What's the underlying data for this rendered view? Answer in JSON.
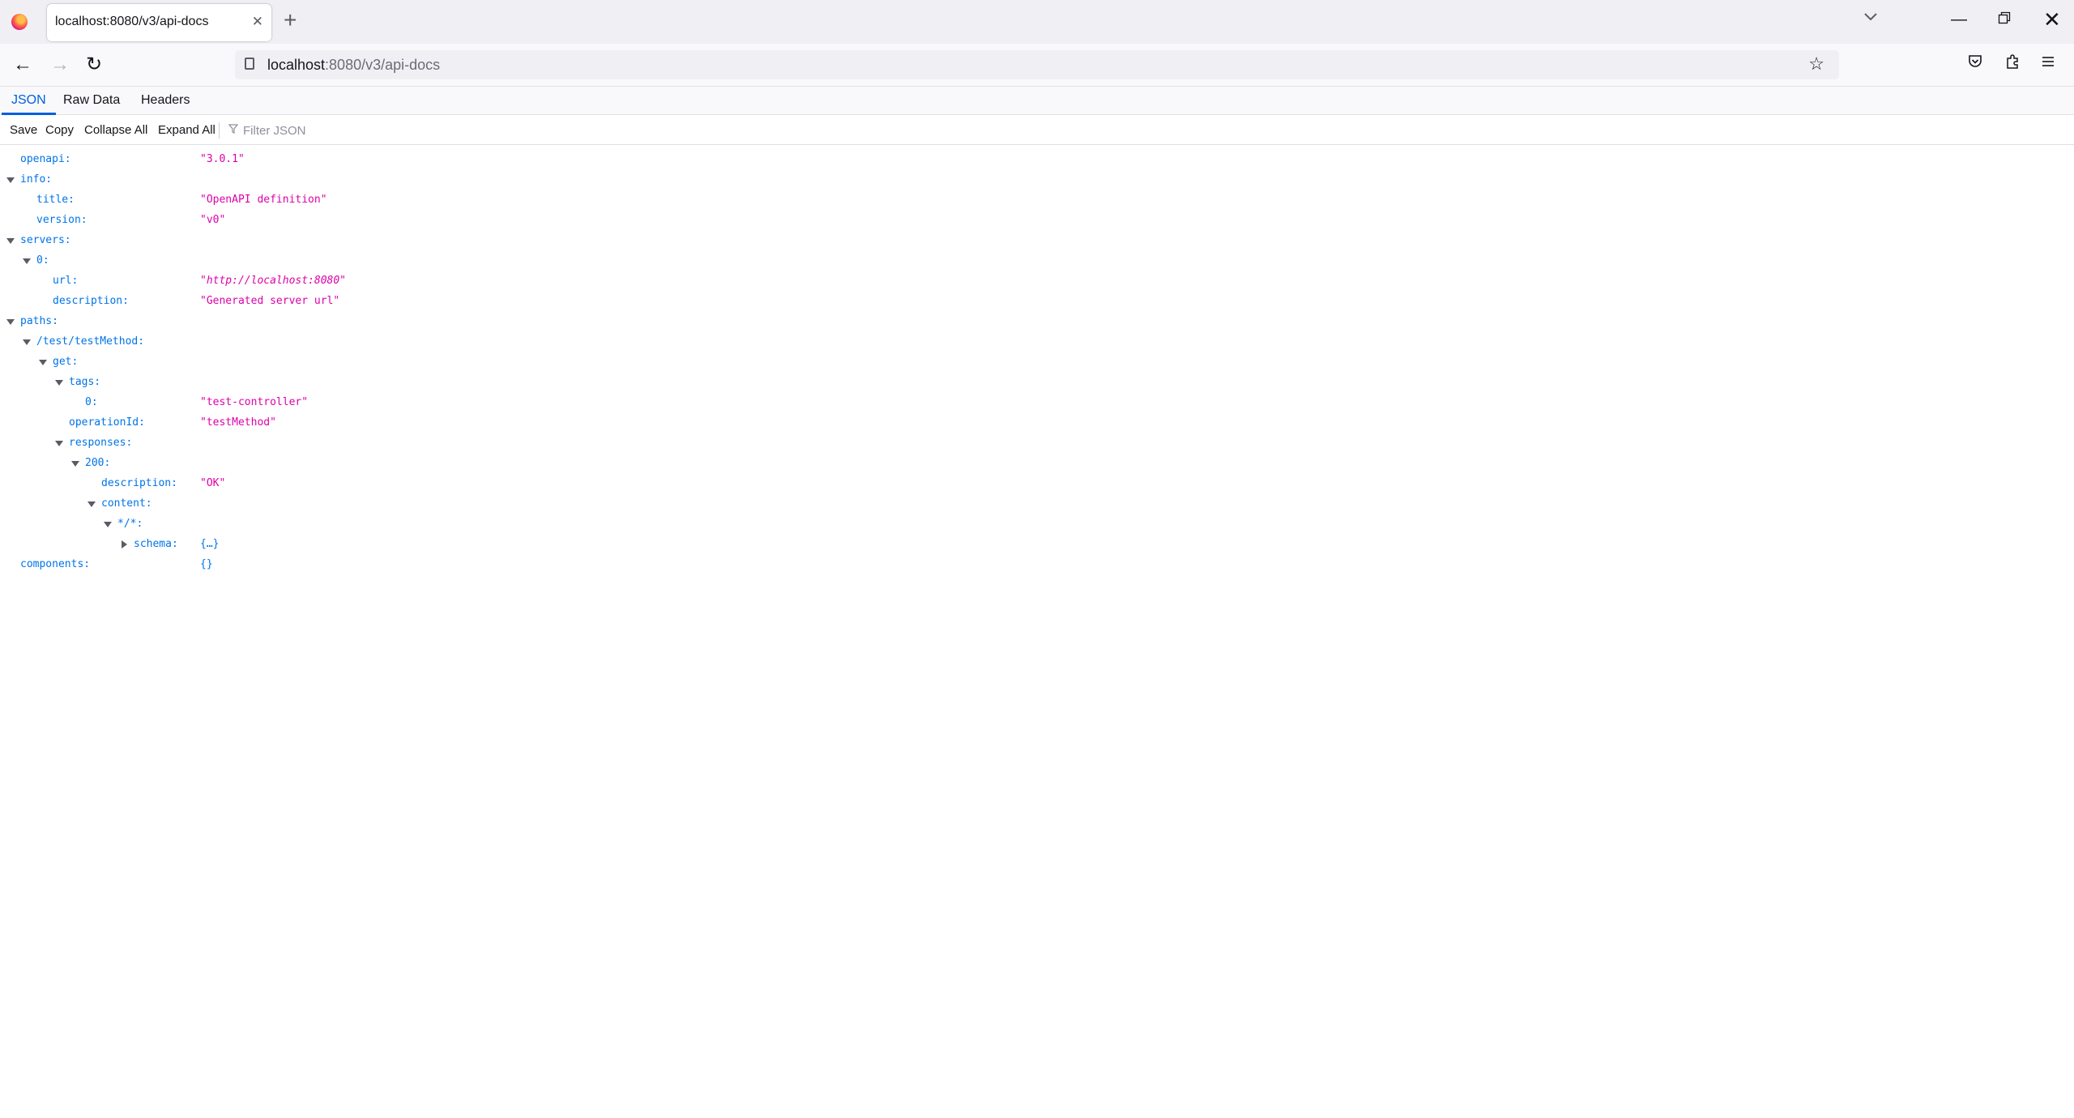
{
  "browser": {
    "tab_title": "localhost:8080/v3/api-docs",
    "url_host": "localhost",
    "url_path": ":8080/v3/api-docs"
  },
  "viewer": {
    "tabs": [
      "JSON",
      "Raw Data",
      "Headers"
    ],
    "selected_tab": "JSON",
    "toolbar": {
      "save": "Save",
      "copy": "Copy",
      "collapse_all": "Collapse All",
      "expand_all": "Expand All",
      "filter_placeholder": "Filter JSON"
    }
  },
  "tree": [
    {
      "key": "openapi:",
      "value": "\"3.0.1\"",
      "depth": 0,
      "twisty": "none"
    },
    {
      "key": "info:",
      "value": "",
      "depth": 0,
      "twisty": "expanded"
    },
    {
      "key": "title:",
      "value": "\"OpenAPI definition\"",
      "depth": 1,
      "twisty": "none"
    },
    {
      "key": "version:",
      "value": "\"v0\"",
      "depth": 1,
      "twisty": "none"
    },
    {
      "key": "servers:",
      "value": "",
      "depth": 0,
      "twisty": "expanded"
    },
    {
      "key": "0:",
      "value": "",
      "depth": 1,
      "twisty": "expanded"
    },
    {
      "key": "url:",
      "value": "\"http://localhost:8080\"",
      "depth": 2,
      "twisty": "none",
      "kind": "url"
    },
    {
      "key": "description:",
      "value": "\"Generated server url\"",
      "depth": 2,
      "twisty": "none"
    },
    {
      "key": "paths:",
      "value": "",
      "depth": 0,
      "twisty": "expanded"
    },
    {
      "key": "/test/testMethod:",
      "value": "",
      "depth": 1,
      "twisty": "expanded"
    },
    {
      "key": "get:",
      "value": "",
      "depth": 2,
      "twisty": "expanded"
    },
    {
      "key": "tags:",
      "value": "",
      "depth": 3,
      "twisty": "expanded"
    },
    {
      "key": "0:",
      "value": "\"test-controller\"",
      "depth": 4,
      "twisty": "none"
    },
    {
      "key": "operationId:",
      "value": "\"testMethod\"",
      "depth": 3,
      "twisty": "none"
    },
    {
      "key": "responses:",
      "value": "",
      "depth": 3,
      "twisty": "expanded"
    },
    {
      "key": "200:",
      "value": "",
      "depth": 4,
      "twisty": "expanded"
    },
    {
      "key": "description:",
      "value": "\"OK\"",
      "depth": 5,
      "twisty": "none"
    },
    {
      "key": "content:",
      "value": "",
      "depth": 5,
      "twisty": "expanded"
    },
    {
      "key": "*/*:",
      "value": "",
      "depth": 6,
      "twisty": "expanded"
    },
    {
      "key": "schema:",
      "value": "{…}",
      "depth": 7,
      "twisty": "collapsed",
      "kind": "obj"
    },
    {
      "key": "components:",
      "value": "{}",
      "depth": 0,
      "twisty": "none",
      "kind": "obj"
    }
  ]
}
